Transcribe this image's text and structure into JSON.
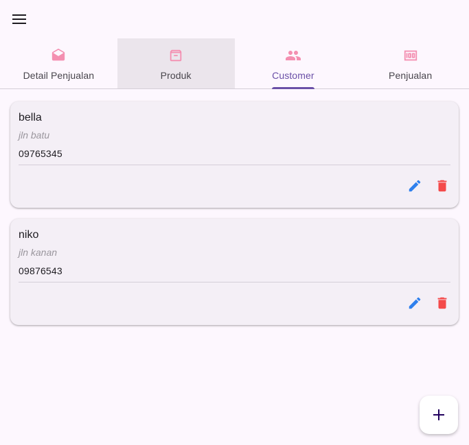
{
  "tabs": [
    {
      "label": "Detail Penjualan",
      "icon": "drafts-icon"
    },
    {
      "label": "Produk",
      "icon": "archive-icon"
    },
    {
      "label": "Customer",
      "icon": "people-icon"
    },
    {
      "label": "Penjualan",
      "icon": "money-icon"
    }
  ],
  "active_tab": "Customer",
  "customers": [
    {
      "name": "bella",
      "address": "jln batu",
      "phone": "09765345"
    },
    {
      "name": "niko",
      "address": "jln kanan",
      "phone": "09876543"
    }
  ],
  "colors": {
    "accent": "#6a4fa7",
    "tab_icon": "#f48fb1",
    "edit": "#2f80ed",
    "delete": "#f44a4a",
    "background": "#fdf7fe",
    "card": "#f4eff6"
  }
}
